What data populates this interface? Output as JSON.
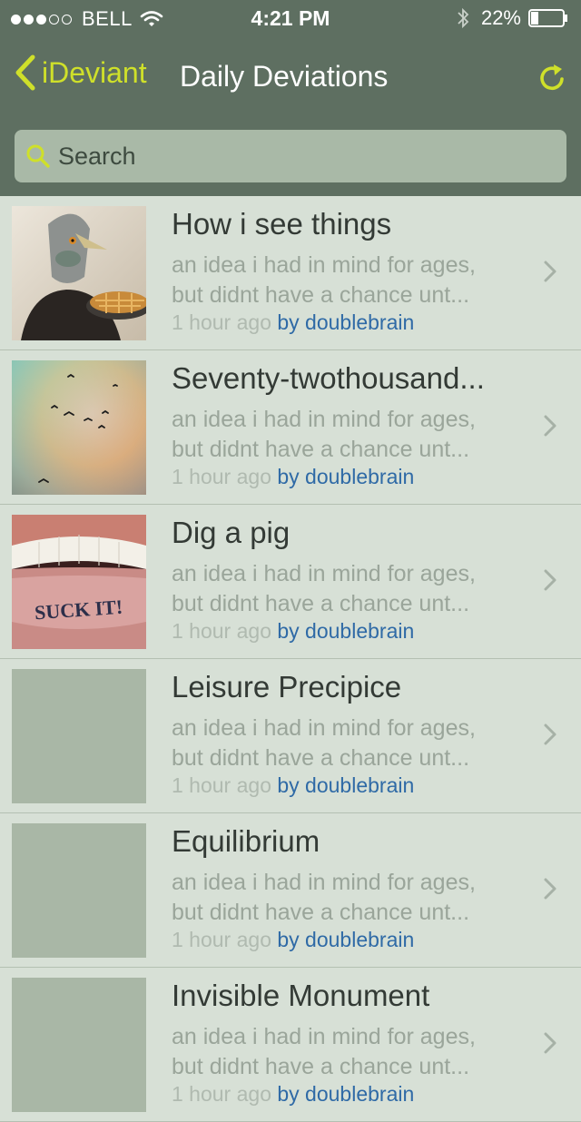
{
  "colors": {
    "accent": "#cfe02a",
    "header_bg": "#5e6f61",
    "list_bg": "#d7e0d6",
    "author_link": "#2f6aa6"
  },
  "status_bar": {
    "carrier": "BELL",
    "time": "4:21 PM",
    "battery": "22%",
    "signal_bars": 3,
    "signal_total": 5,
    "battery_level": 0.22
  },
  "nav": {
    "back_label": "iDeviant",
    "title": "Daily Deviations",
    "refresh_icon": "refresh-icon"
  },
  "search": {
    "placeholder": "Search"
  },
  "items": [
    {
      "title": "How i see things",
      "desc_line1": "an idea i had in mind for ages,",
      "desc_line2": "but didnt have a chance unt...",
      "time": "1 hour ago",
      "author": "by doublebrain",
      "thumb": "pigeon-mask"
    },
    {
      "title": "Seventy-twothousand...",
      "desc_line1": "an idea i had in mind for ages,",
      "desc_line2": "but didnt have a chance unt...",
      "time": "1 hour ago",
      "author": "by doublebrain",
      "thumb": "birds-sky"
    },
    {
      "title": "Dig a pig",
      "desc_line1": "an idea i had in mind for ages,",
      "desc_line2": "but didnt have a chance unt...",
      "time": "1 hour ago",
      "author": "by doublebrain",
      "thumb": "lip-tattoo",
      "thumb_text": "SUCK IT!"
    },
    {
      "title": "Leisure Precipice",
      "desc_line1": "an idea i had in mind for ages,",
      "desc_line2": "but didnt have a chance unt...",
      "time": "1 hour ago",
      "author": "by doublebrain",
      "thumb": "placeholder"
    },
    {
      "title": "Equilibrium",
      "desc_line1": "an idea i had in mind for ages,",
      "desc_line2": "but didnt have a chance unt...",
      "time": "1 hour ago",
      "author": "by doublebrain",
      "thumb": "placeholder"
    },
    {
      "title": "Invisible Monument",
      "desc_line1": "an idea i had in mind for ages,",
      "desc_line2": "but didnt have a chance unt...",
      "time": "1 hour ago",
      "author": "by doublebrain",
      "thumb": "placeholder"
    }
  ]
}
